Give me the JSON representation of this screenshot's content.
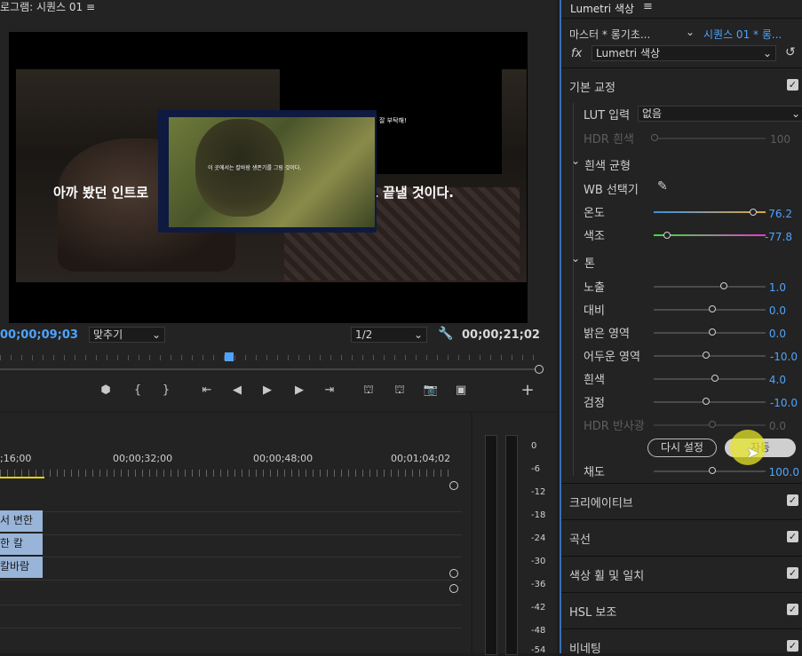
{
  "program": {
    "title": "로그램: 시퀀스 01 ≡",
    "overlay_text_left": "아까 봤던 인트로",
    "overlay_text_right": "고 끝낼 것이다.",
    "pip_caption": "이 곳에서는 칼바람 생존기를 그림 것이다.",
    "small_text": "잘 부탁해!",
    "timecode_current": "00;00;09;03",
    "fit_label": "맞추기",
    "resolution_label": "1/2",
    "timecode_duration": "00;00;21;02"
  },
  "timeline": {
    "times": [
      ";16;00",
      "00;00;32;00",
      "00;00;48;00",
      "00;01;04;02"
    ],
    "clips": [
      "서 변한",
      "한 칼",
      "칼바람"
    ]
  },
  "meter": {
    "scale": [
      "0",
      "-6",
      "-12",
      "-18",
      "-24",
      "-30",
      "-36",
      "-42",
      "-48",
      "-54"
    ]
  },
  "lumetri": {
    "title": "Lumetri 색상",
    "menu_glyph": "≡",
    "master_clip": "마스터 * 롱기초...",
    "sequence_clip": "시퀀스 01 * 롱...",
    "fx_label": "fx",
    "effect_name": "Lumetri 색상",
    "basic_correction": "기본 교정",
    "lut_label": "LUT 입력",
    "lut_value": "없음",
    "hdr_white_label": "HDR 흰색",
    "hdr_white_value": "100",
    "wb_section": "흰색 균형",
    "wb_selector": "WB 선택기",
    "temp_label": "온도",
    "temp_value": "76.2",
    "tint_label": "색조",
    "tint_value": "-77.8",
    "tone_section": "톤",
    "sliders": [
      {
        "label": "노출",
        "value": "1.0"
      },
      {
        "label": "대비",
        "value": "0.0"
      },
      {
        "label": "밝은 영역",
        "value": "0.0"
      },
      {
        "label": "어두운 영역",
        "value": "-10.0"
      },
      {
        "label": "흰색",
        "value": "4.0"
      },
      {
        "label": "검정",
        "value": "-10.0"
      }
    ],
    "hdr_specular_label": "HDR 반사광",
    "hdr_specular_value": "0.0",
    "reset_button": "다시 설정",
    "auto_button": "자동",
    "saturation_label": "채도",
    "saturation_value": "100.0",
    "sections": [
      "크리에이티브",
      "곡선",
      "색상 휠 및 일치",
      "HSL 보조",
      "비네팅"
    ]
  }
}
